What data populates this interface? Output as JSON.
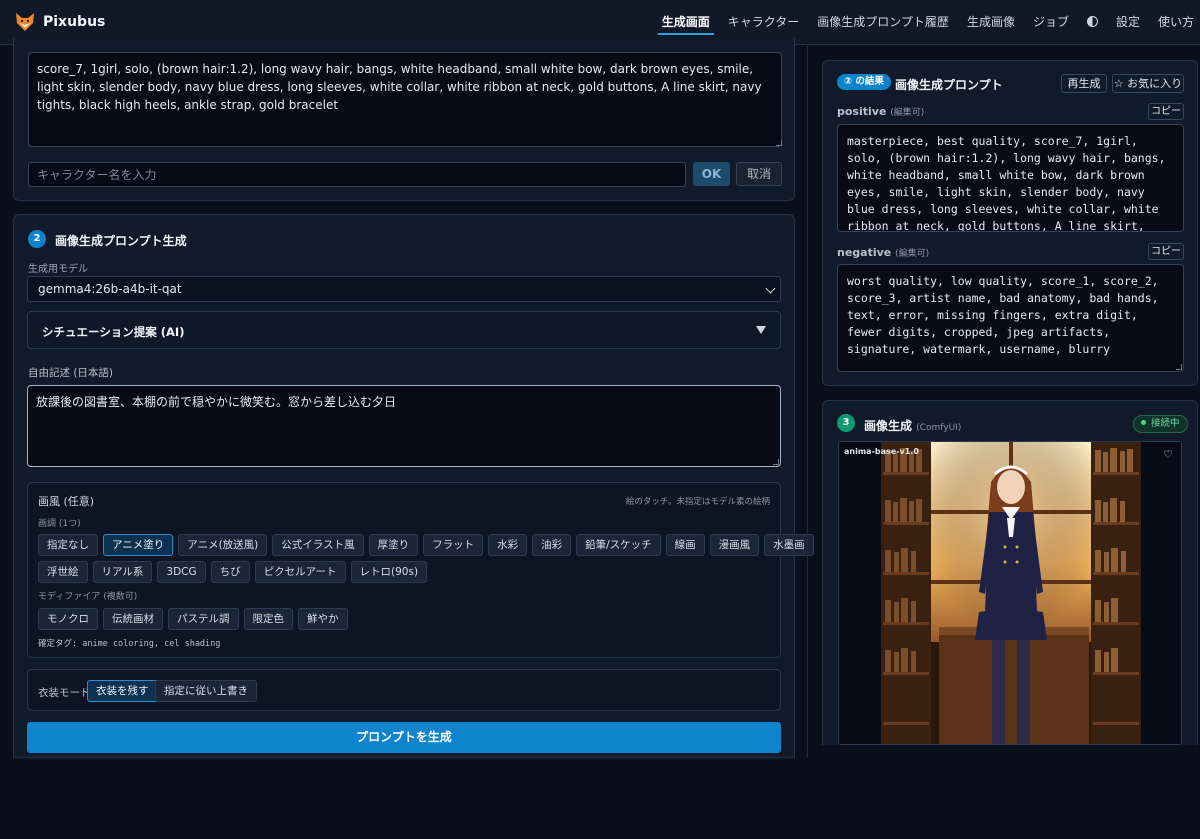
{
  "app": {
    "title": "Pixubus"
  },
  "nav": {
    "items": [
      {
        "label": "生成画面",
        "active": true
      },
      {
        "label": "キャラクター"
      },
      {
        "label": "画像生成プロンプト履歴"
      },
      {
        "label": "生成画像"
      },
      {
        "label": "ジョブ"
      },
      {
        "label": "設定"
      },
      {
        "label": "使い方"
      }
    ],
    "theme_icon": "half-circle-icon"
  },
  "character": {
    "tags_text": "score_7, 1girl, solo, (brown hair:1.2), long wavy hair, bangs, white headband, small white bow, dark brown eyes, smile, light skin, slender body, navy blue dress, long sleeves, white collar, white ribbon at neck, gold buttons, A line skirt, navy tights, black high heels, ankle strap, gold bracelet",
    "name_placeholder": "キャラクター名を入力",
    "ok_label": "OK",
    "cancel_label": "取消"
  },
  "prompt_gen": {
    "step": "2",
    "title": "画像生成プロンプト生成",
    "model_label": "生成用モデル",
    "model_value": "gemma4:26b-a4b-it-qat",
    "situation_label": "シチュエーション提案 (AI)",
    "free_label": "自由記述 (日本語)",
    "free_text": "放課後の図書室、本棚の前で穏やかに微笑む。窓から差し込む夕日",
    "style": {
      "title": "画風 (任意)",
      "hint": "絵のタッチ。未指定はモデル素の絵柄",
      "sub_label": "画調 (1つ)",
      "row1": [
        "指定なし",
        "アニメ塗り",
        "アニメ(放送風)",
        "公式イラスト風",
        "厚塗り",
        "フラット",
        "水彩",
        "油彩",
        "鉛筆/スケッチ",
        "線画",
        "漫画風",
        "水墨画"
      ],
      "row2": [
        "浮世絵",
        "リアル系",
        "3DCG",
        "ちび",
        "ピクセルアート",
        "レトロ(90s)"
      ],
      "selected": "アニメ塗り",
      "modifier_label": "モディファイア (複数可)",
      "modifiers": [
        "モノクロ",
        "伝統画材",
        "パステル調",
        "限定色",
        "鮮やか"
      ],
      "confirmed": "確定タグ: anime coloring, cel shading"
    },
    "outfit_label": "衣装モード",
    "outfit_keep": "衣装を残す",
    "outfit_override": "指定に従い上書き",
    "generate_label": "プロンプトを生成"
  },
  "result": {
    "badge": "② の結果",
    "title": "画像生成プロンプト",
    "regenerate": "再生成",
    "favorite": "☆ お気に入り",
    "positive_label": "positive",
    "positive_edit": "(編集可)",
    "copy": "コピー",
    "positive_text": "masterpiece, best quality, score_7, 1girl, solo, (brown hair:1.2), long wavy hair, bangs, white headband, small white bow, dark brown eyes, smile, light skin, slender body, navy blue dress, long sleeves, white collar, white ribbon at neck, gold buttons, A line skirt, navy tights, black high heels, ankle strap, gold bracelet",
    "negative_label": "negative",
    "negative_edit": "(編集可)",
    "negative_text": "worst quality, low quality, score_1, score_2, score_3, artist name, bad anatomy, bad hands, text, error, missing fingers, extra digit, fewer digits, cropped, jpeg artifacts, signature, watermark, username, blurry"
  },
  "image_gen": {
    "step": "3",
    "title": "画像生成",
    "sub": "(ComfyUI)",
    "status": "接続中",
    "model_tag": "anima-base-v1.0"
  },
  "colors": {
    "accent": "#0d84cc",
    "bg": "#0a0f1c",
    "panel": "#111a2b",
    "success": "#3ee08f"
  }
}
